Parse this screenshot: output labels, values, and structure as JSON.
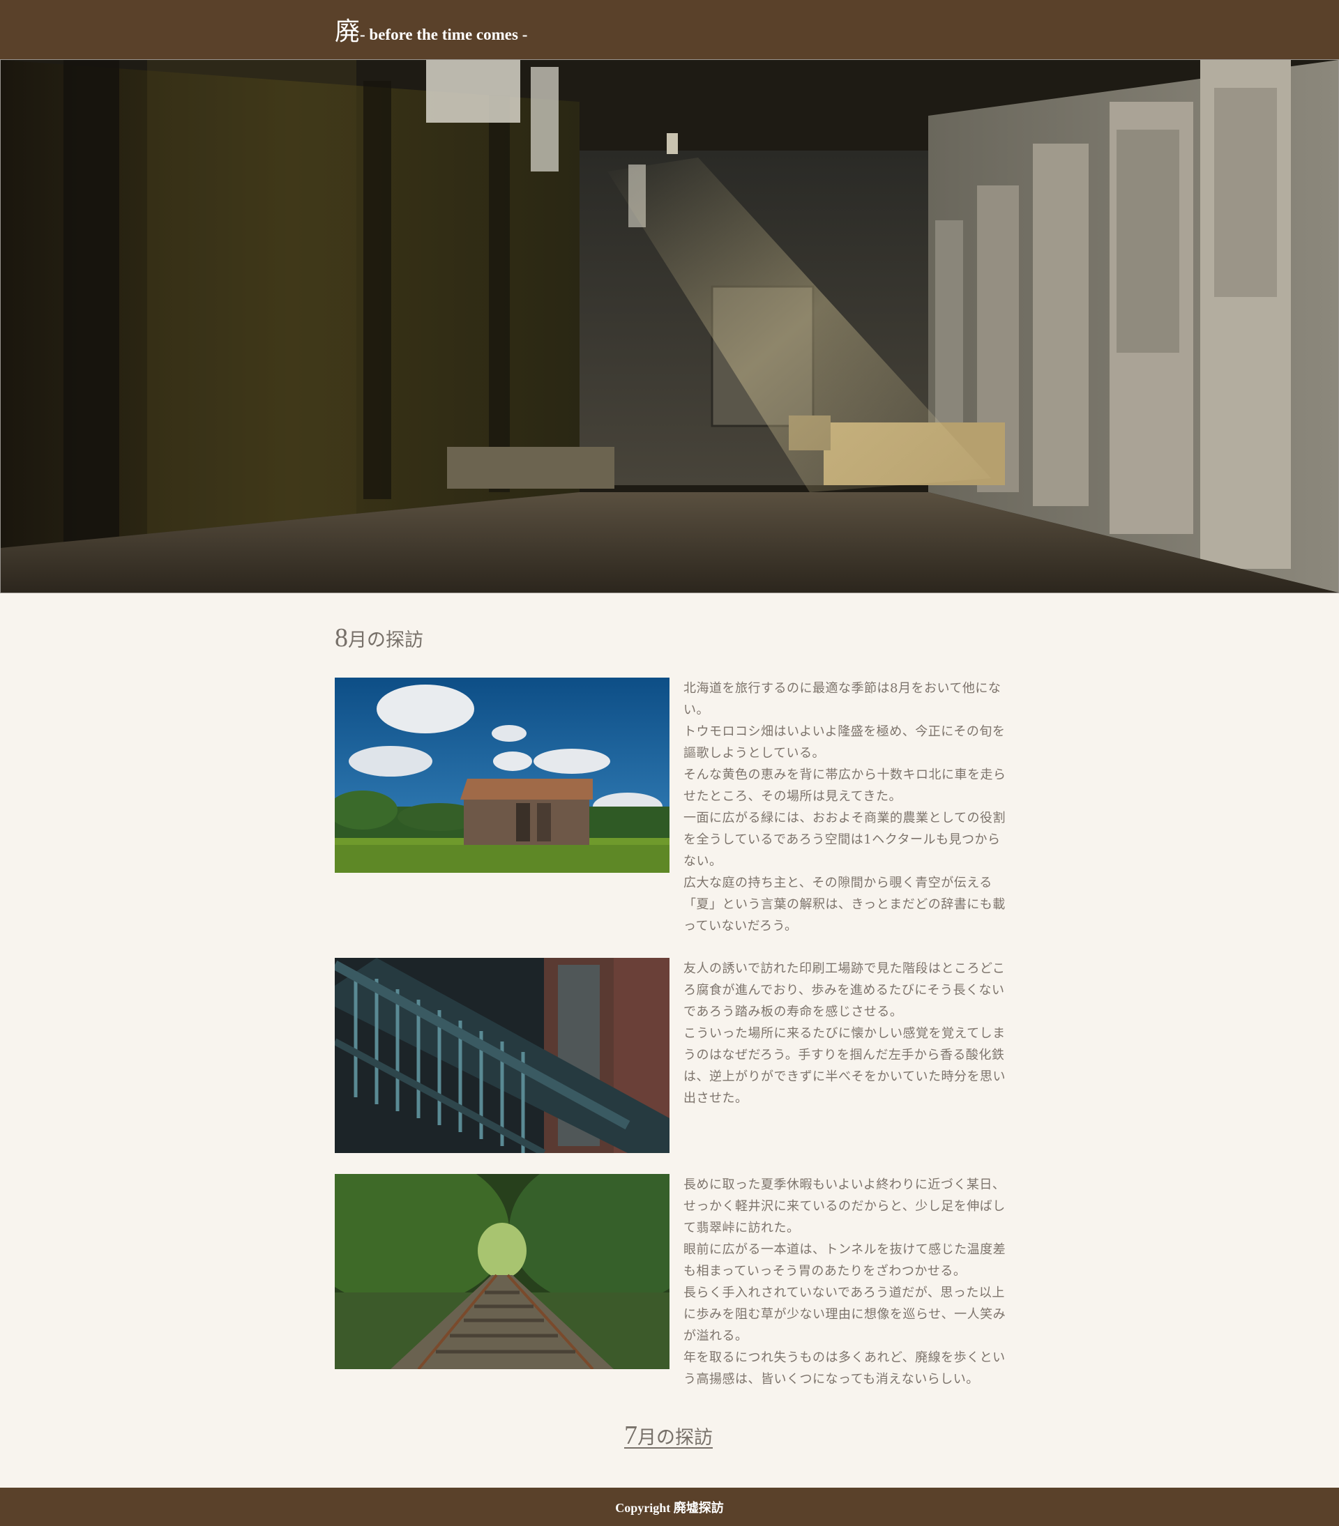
{
  "header": {
    "site_kanji": "廃",
    "site_tagline": "- before the time comes -"
  },
  "sections": [
    {
      "heading_number": "8",
      "heading_rest": "月の探訪",
      "articles": [
        {
          "image": "abandoned-barn-photo",
          "paragraphs": [
            "北海道を旅行するのに最適な季節は8月をおいて他にない。",
            "トウモロコシ畑はいよいよ隆盛を極め、今正にその旬を謳歌しようとしている。",
            "そんな黄色の恵みを背に帯広から十数キロ北に車を走らせたところ、その場所は見えてきた。",
            "一面に広がる緑には、おおよそ商業的農業としての役割を全うしているであろう空間は1ヘクタールも見つからない。",
            "広大な庭の持ち主と、その隙間から覗く青空が伝える「夏」という言葉の解釈は、きっとまだどの辞書にも載っていないだろう。"
          ]
        },
        {
          "image": "rusty-staircase-photo",
          "paragraphs": [
            "友人の誘いで訪れた印刷工場跡で見た階段はところどころ腐食が進んでおり、歩みを進めるたびにそう長くないであろう踏み板の寿命を感じさせる。",
            "こういった場所に来るたびに懐かしい感覚を覚えてしまうのはなぜだろう。手すりを掴んだ左手から香る酸化鉄は、逆上がりができずに半べそをかいていた時分を思い出させた。"
          ]
        },
        {
          "image": "abandoned-railway-photo",
          "paragraphs": [
            "長めに取った夏季休暇もいよいよ終わりに近づく某日、せっかく軽井沢に来ているのだからと、少し足を伸ばして翡翠峠に訪れた。",
            "眼前に広がる一本道は、トンネルを抜けて感じた温度差も相まっていっそう胃のあたりをざわつかせる。",
            "長らく手入れされていないであろう道だが、思った以上に歩みを阻む草が少ない理由に想像を巡らせ、一人笑みが溢れる。",
            "年を取るにつれ失うものは多くあれど、廃線を歩くという高揚感は、皆いくつになっても消えないらしい。"
          ]
        }
      ]
    }
  ],
  "next_section": {
    "heading_number": "7",
    "heading_rest": "月の探訪"
  },
  "footer": {
    "copyright": "Copyright 廃墟探訪"
  },
  "colors": {
    "header_bg": "#5a412a",
    "page_bg": "#f8f4ee",
    "text": "#7c736b"
  }
}
